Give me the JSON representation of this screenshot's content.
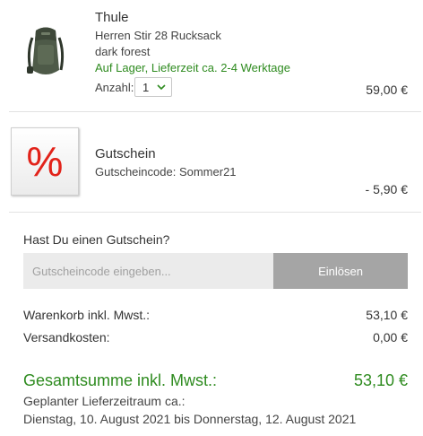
{
  "product": {
    "image_icon": "backpack-image",
    "brand": "Thule",
    "name": "Herren Stir 28 Rucksack",
    "color": "dark forest",
    "availability": "Auf Lager, Lieferzeit ca. 2-4 Werktage",
    "quantity_label": "Anzahl:",
    "quantity_value": "1",
    "price": "59,00 €"
  },
  "voucher": {
    "icon_symbol": "%",
    "title": "Gutschein",
    "code_line": "Gutscheincode: Sommer21",
    "price": "- 5,90 €"
  },
  "coupon": {
    "question": "Hast Du einen Gutschein?",
    "placeholder": "Gutscheincode eingeben...",
    "button_label": "Einlösen"
  },
  "summary": {
    "cart_label": "Warenkorb inkl. Mwst.:",
    "cart_value": "53,10 €",
    "shipping_label": "Versandkosten:",
    "shipping_value": "0,00 €",
    "total_label": "Gesamtsumme inkl. Mwst.:",
    "total_value": "53,10 €",
    "delivery_label": "Geplanter Lieferzeitraum ca.:",
    "delivery_range": "Dienstag, 10. August 2021 bis Donnerstag, 12. August 2021"
  },
  "colors": {
    "accent_green": "#2e8b1f",
    "voucher_red": "#e2231a",
    "button_gray": "#a5a5a5"
  }
}
